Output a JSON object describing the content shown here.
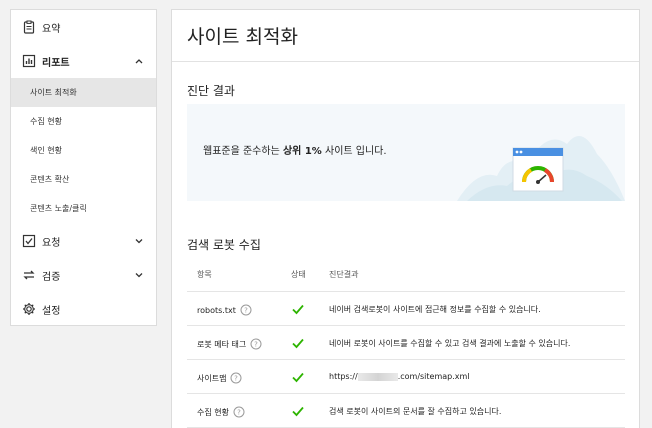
{
  "sidebar": {
    "summary": "요약",
    "report": "리포트",
    "report_items": [
      "사이트 최적화",
      "수집 현황",
      "색인 현황",
      "콘텐츠 확산",
      "콘텐츠 노출/클릭"
    ],
    "request": "요청",
    "verify": "검증",
    "settings": "설정"
  },
  "main": {
    "title": "사이트 최적화",
    "diagnosis": {
      "heading": "진단 결과",
      "text_before": "웹표준을 준수하는 ",
      "text_strong": "상위 1%",
      "text_after": " 사이트 입니다."
    },
    "robot": {
      "heading": "검색 로봇 수집",
      "columns": [
        "항목",
        "상태",
        "진단결과"
      ],
      "rows": [
        {
          "item": "robots.txt",
          "result": "네이버 검색로봇이 사이트에 접근해 정보를 수집할 수 있습니다."
        },
        {
          "item": "로봇 메타 태그",
          "result": "네이버 로봇이 사이트를 수집할 수 있고 검색 결과에 노출할 수 있습니다."
        },
        {
          "item": "사이트맵",
          "result_prefix": "https://",
          "result_suffix": ".com/sitemap.xml"
        },
        {
          "item": "수집 현황",
          "result": "검색 로봇이 사이트의 문서를 잘 수집하고 있습니다."
        }
      ]
    }
  },
  "colors": {
    "check": "#2db400",
    "active_bg": "#e6e6e6",
    "diag_bg": "#f4f8fb",
    "gauge_blue": "#4a90e2"
  },
  "icons": {
    "summary": "clipboard-icon",
    "report": "bar-chart-icon",
    "request": "checkbox-icon",
    "verify": "swap-arrows-icon",
    "settings": "gear-icon",
    "help": "question-circle-icon",
    "status": "check-icon"
  }
}
